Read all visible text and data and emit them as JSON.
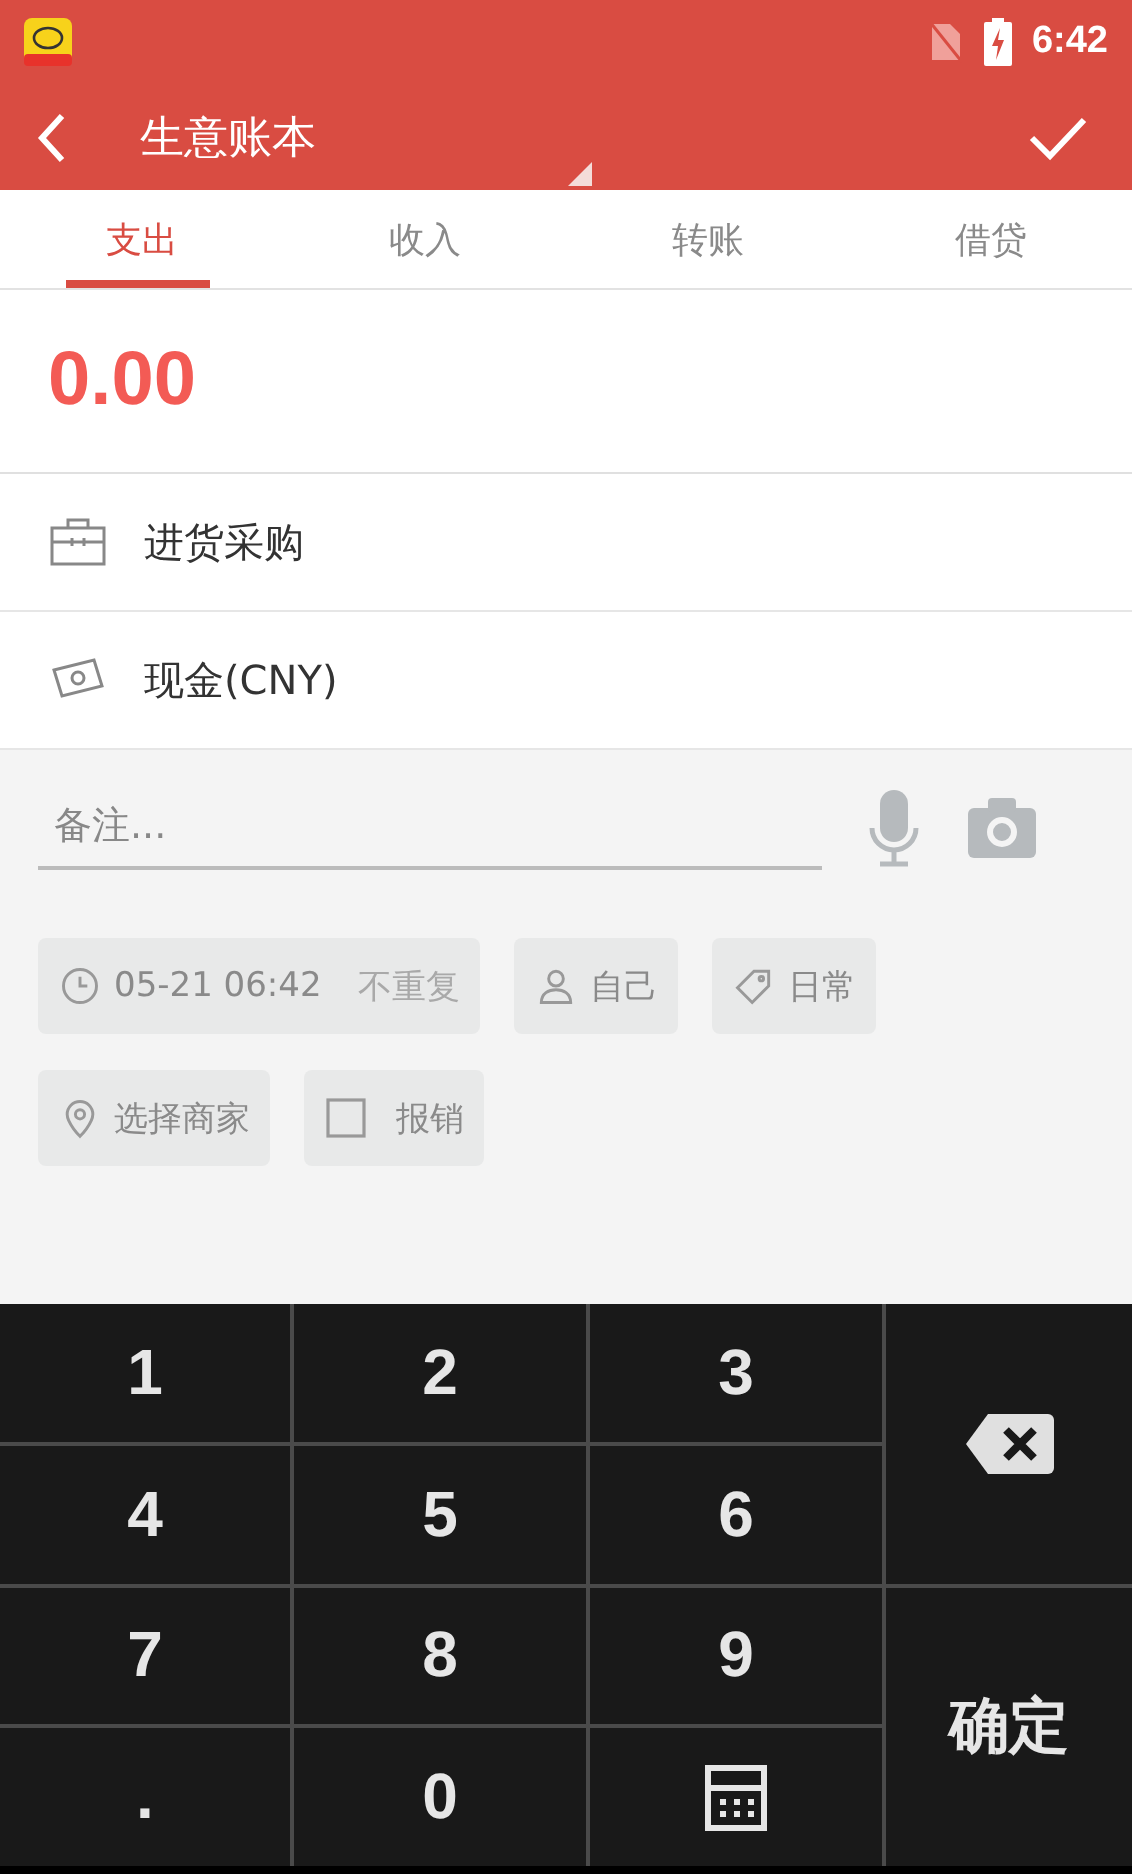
{
  "status_bar": {
    "time": "6:42"
  },
  "toolbar": {
    "title": "生意账本"
  },
  "tabs": [
    {
      "label": "支出",
      "selected": true
    },
    {
      "label": "收入",
      "selected": false
    },
    {
      "label": "转账",
      "selected": false
    },
    {
      "label": "借贷",
      "selected": false
    }
  ],
  "amount": "0.00",
  "rows": [
    {
      "kind": "category",
      "label": "进货采购"
    },
    {
      "kind": "account",
      "label": "现金(CNY)"
    }
  ],
  "note": {
    "placeholder": "备注..."
  },
  "chips": [
    {
      "kind": "time",
      "label": "05-21 06:42",
      "extra": "不重复"
    },
    {
      "kind": "member",
      "label": "自己"
    },
    {
      "kind": "tag",
      "label": "日常"
    },
    {
      "kind": "merchant",
      "label": "选择商家"
    },
    {
      "kind": "reimburse",
      "label": "报销",
      "checked": false
    }
  ],
  "keypad": {
    "keys": [
      {
        "kind": "digit",
        "label": "1"
      },
      {
        "kind": "digit",
        "label": "2"
      },
      {
        "kind": "digit",
        "label": "3"
      },
      {
        "kind": "digit",
        "label": "4"
      },
      {
        "kind": "digit",
        "label": "5"
      },
      {
        "kind": "digit",
        "label": "6"
      },
      {
        "kind": "digit",
        "label": "7"
      },
      {
        "kind": "digit",
        "label": "8"
      },
      {
        "kind": "digit",
        "label": "9"
      },
      {
        "kind": "digit",
        "label": "."
      },
      {
        "kind": "digit",
        "label": "0"
      },
      {
        "kind": "calculator"
      }
    ],
    "confirm": "确定"
  }
}
